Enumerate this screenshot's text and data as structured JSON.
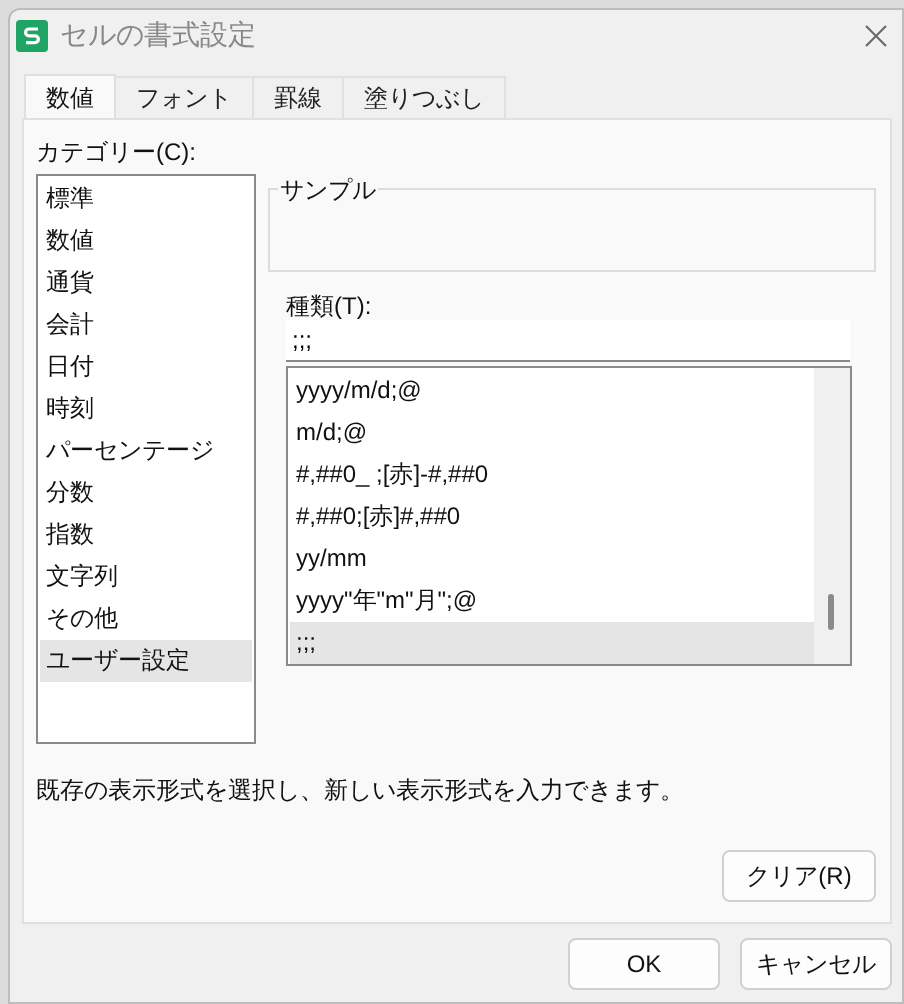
{
  "window": {
    "title": "セルの書式設定"
  },
  "tabs": [
    {
      "label": "数値",
      "selected": true
    },
    {
      "label": "フォント",
      "selected": false
    },
    {
      "label": "罫線",
      "selected": false
    },
    {
      "label": "塗りつぶし",
      "selected": false
    }
  ],
  "category": {
    "label": "カテゴリー(C):",
    "items": [
      {
        "label": "標準",
        "selected": false
      },
      {
        "label": "数値",
        "selected": false
      },
      {
        "label": "通貨",
        "selected": false
      },
      {
        "label": "会計",
        "selected": false
      },
      {
        "label": "日付",
        "selected": false
      },
      {
        "label": "時刻",
        "selected": false
      },
      {
        "label": "パーセンテージ",
        "selected": false
      },
      {
        "label": "分数",
        "selected": false
      },
      {
        "label": "指数",
        "selected": false
      },
      {
        "label": "文字列",
        "selected": false
      },
      {
        "label": "その他",
        "selected": false
      },
      {
        "label": "ユーザー設定",
        "selected": true
      }
    ]
  },
  "sample": {
    "label": "サンプル"
  },
  "type": {
    "label": "種類(T):",
    "value": ";;;",
    "items": [
      {
        "label": "yyyy/m/d;@",
        "selected": false
      },
      {
        "label": "m/d;@",
        "selected": false
      },
      {
        "label": "#,##0_ ;[赤]-#,##0",
        "selected": false
      },
      {
        "label": "#,##0;[赤]#,##0",
        "selected": false
      },
      {
        "label": "yy/mm",
        "selected": false
      },
      {
        "label": "yyyy\"年\"m\"月\";@",
        "selected": false
      },
      {
        "label": ";;;",
        "selected": true
      }
    ]
  },
  "description": "既存の表示形式を選択し、新しい表示形式を入力できます。",
  "clear_button": "クリア(R)",
  "buttons": [
    "OK",
    "キャンセル"
  ]
}
